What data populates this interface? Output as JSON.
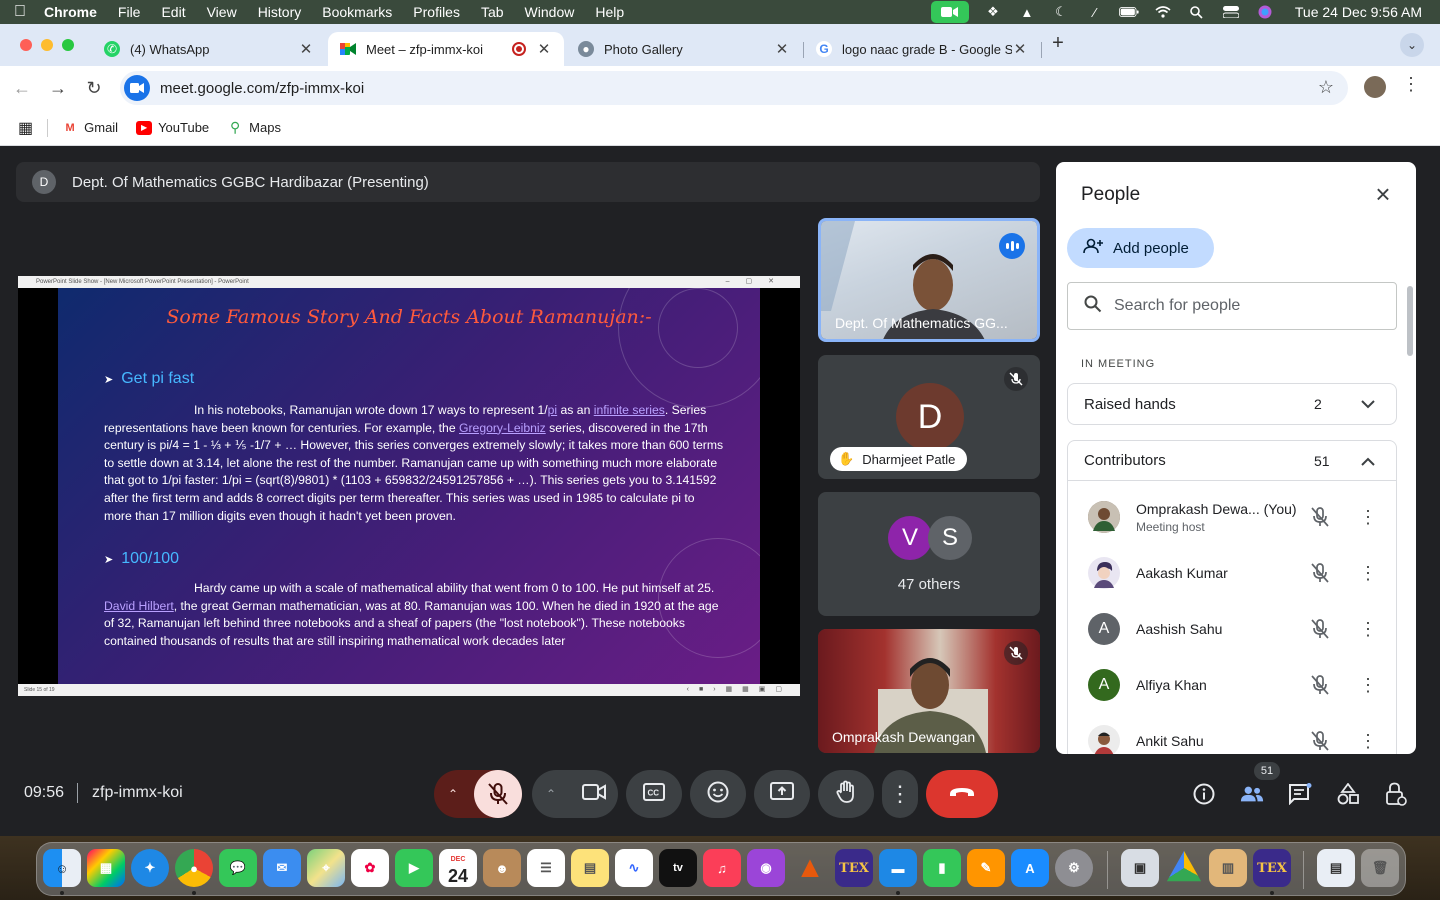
{
  "menubar": {
    "app_name": "Chrome",
    "items": [
      "File",
      "Edit",
      "View",
      "History",
      "Bookmarks",
      "Profiles",
      "Tab",
      "Window",
      "Help"
    ],
    "clock": "Tue 24 Dec  9:56 AM"
  },
  "tabs": [
    {
      "title": "(4) WhatsApp",
      "icon": "whatsapp-icon"
    },
    {
      "title": "Meet – zfp-immx-koi",
      "icon": "meet-icon",
      "active": true
    },
    {
      "title": "Photo Gallery",
      "icon": "globe-icon"
    },
    {
      "title": "logo naac grade B - Google S",
      "icon": "google-icon"
    }
  ],
  "toolbar": {
    "url": "meet.google.com/zfp-immx-koi"
  },
  "bookmarks": [
    {
      "label": "Gmail",
      "icon": "gmail-icon"
    },
    {
      "label": "YouTube",
      "icon": "youtube-icon"
    },
    {
      "label": "Maps",
      "icon": "maps-icon"
    }
  ],
  "meet": {
    "presenting": {
      "avatar_letter": "D",
      "label": "Dept. Of Mathematics GGBC Hardibazar (Presenting)"
    },
    "slide": {
      "window_title": "PowerPoint Slide Show - [New Microsoft PowerPoint Presentation] - PowerPoint",
      "status": "Slide 15 of 19",
      "title": "Some Famous Story And Facts About Ramanujan:-",
      "heading1": "Get pi fast",
      "para1": {
        "t1": "In his notebooks, Ramanujan wrote down 17 ways to represent 1/",
        "l1": "pi",
        "t2": " as an ",
        "l2": "infinite series",
        "t3": ". Series representations have been known for centuries. For example, the ",
        "l3": "Gregory-Leibniz",
        "t4": " series, discovered in the 17th century is pi/4 = 1 - ⅓ + ⅕ -1/7 + … However, this series converges extremely slowly; it takes more than 600 terms to settle down at 3.14, let alone the rest of the number. Ramanujan came up with something much more elaborate that got to 1/pi faster: 1/pi = (sqrt(8)/9801) * (1103 + 659832/24591257856 + …). This series gets you to 3.141592 after the first term and adds 8 correct digits per term thereafter. This series was used in 1985 to calculate pi to more than 17 million digits even though it hadn't yet been proven."
      },
      "heading2": "100/100",
      "para2": {
        "t1": "Hardy came up with a scale of mathematical ability that went from 0 to 100. He put himself at 25. ",
        "l1": "David Hilbert",
        "t2": ", the great German mathematician, was at 80. Ramanujan was 100. When he died in 1920 at the age of 32, Ramanujan left behind three notebooks and a sheaf of papers (the \"lost notebook\"). These notebooks contained thousands of results that are still inspiring mathematical work decades later"
      }
    },
    "tiles": {
      "presenter_name": "Dept. Of Mathematics GG...",
      "raised_letter": "D",
      "raised_name": "Dharmjeet Patle",
      "others_letters": [
        "V",
        "S"
      ],
      "others_label": "47 others",
      "self_name": "Omprakash Dewangan"
    },
    "people": {
      "title": "People",
      "add_label": "Add people",
      "search_placeholder": "Search for people",
      "section": "IN MEETING",
      "raised_hands": {
        "label": "Raised hands",
        "count": "2"
      },
      "contributors": {
        "label": "Contributors",
        "count": "51"
      },
      "list": [
        {
          "name": "Omprakash Dewa...  (You)",
          "sub": "Meeting host",
          "avatar": "photo"
        },
        {
          "name": "Aakash Kumar",
          "avatar": "photo"
        },
        {
          "name": "Aashish Sahu",
          "letter": "A",
          "color": "#5f6368"
        },
        {
          "name": "Alfiya Khan",
          "letter": "A",
          "color": "#33691e"
        },
        {
          "name": "Ankit Sahu",
          "avatar": "photo"
        }
      ]
    },
    "controls": {
      "time": "09:56",
      "code": "zfp-immx-koi",
      "participants_badge": "51"
    }
  },
  "dock": {
    "calendar_month": "DEC",
    "calendar_day": "24"
  },
  "colors": {
    "accent": "#1a73e8",
    "end_call": "#dc362e",
    "mic_off": "#f9dedc",
    "slide_title": "#ff5a3c",
    "slide_heading": "#46b8ff"
  }
}
